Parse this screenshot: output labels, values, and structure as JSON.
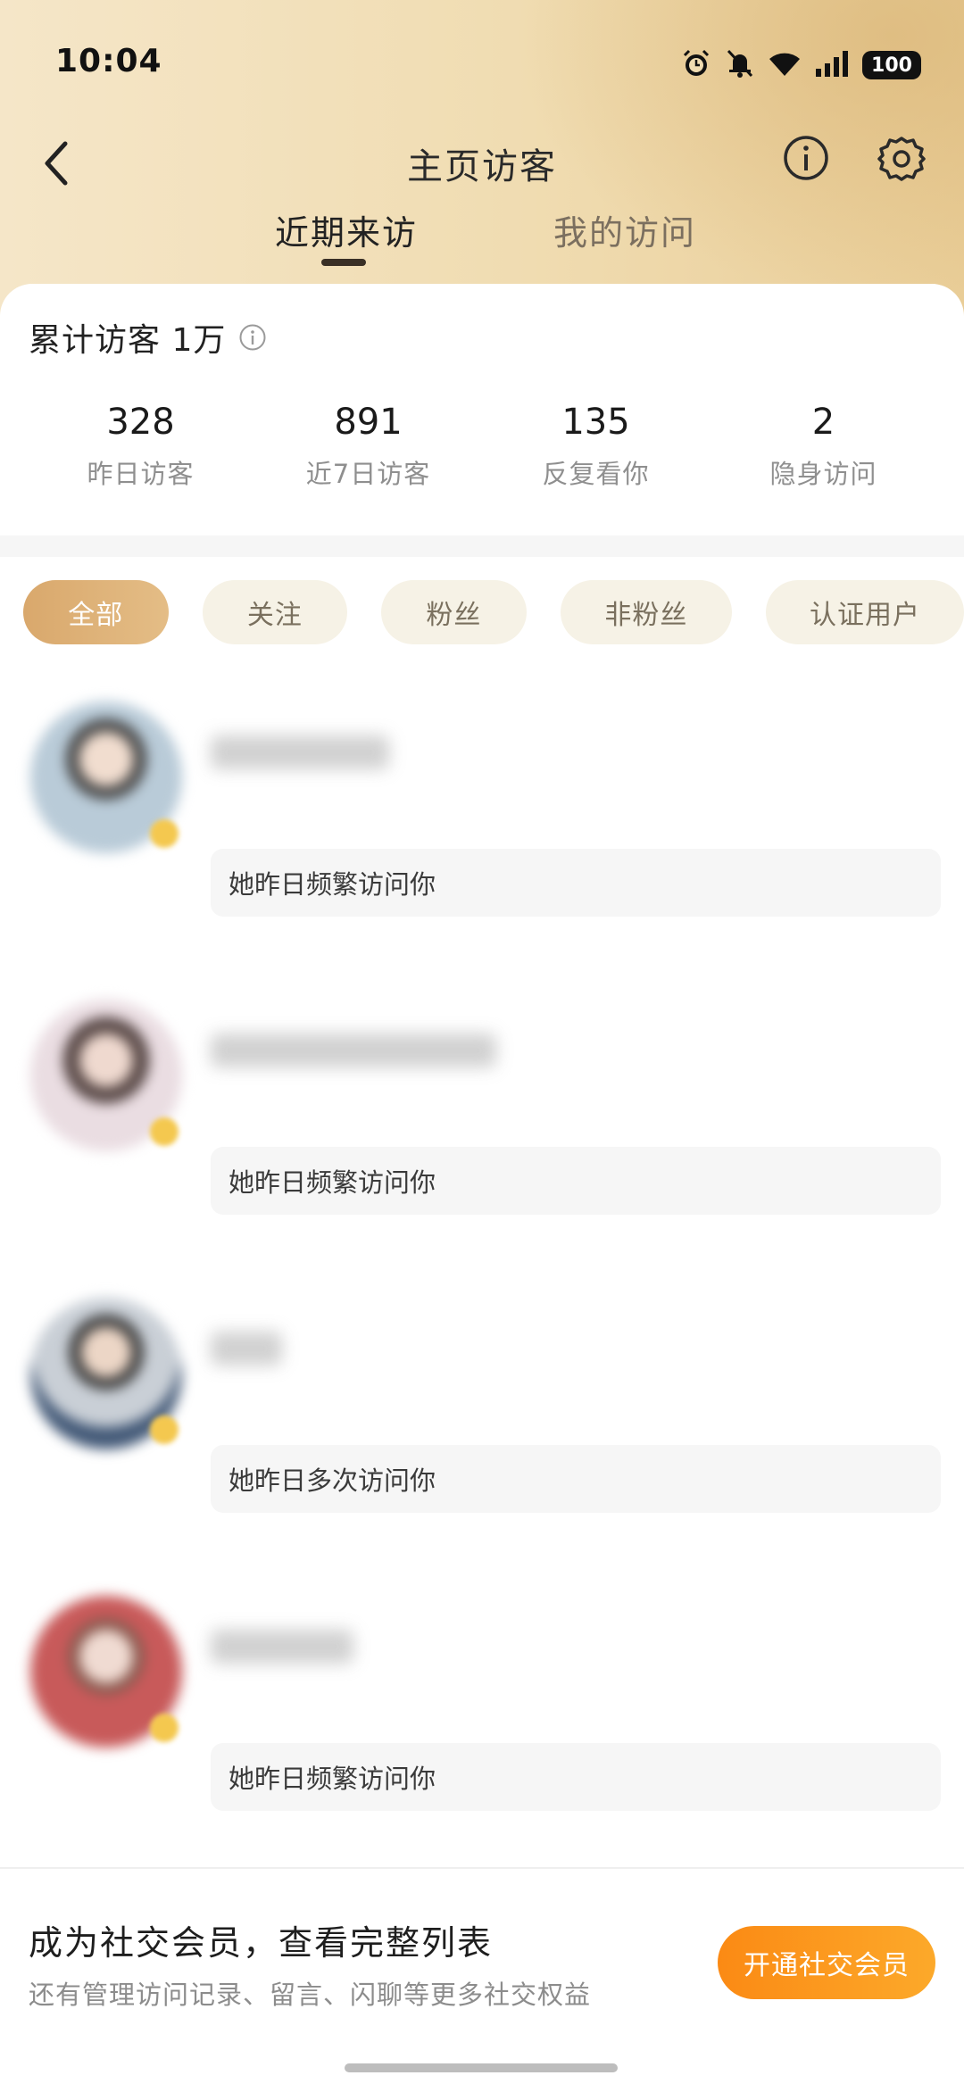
{
  "status_bar": {
    "time": "10:04",
    "battery": "100",
    "icons": [
      "alarm-icon",
      "mute-icon",
      "wifi-icon",
      "signal-icon",
      "battery-icon"
    ]
  },
  "header": {
    "title": "主页访客",
    "back_icon": "chevron-left-icon",
    "info_icon": "info-icon",
    "settings_icon": "gear-icon"
  },
  "tabs": [
    {
      "label": "近期来访",
      "active": true
    },
    {
      "label": "我的访问",
      "active": false
    }
  ],
  "summary": {
    "total_label": "累计访客 1万"
  },
  "stats": [
    {
      "value": "328",
      "label": "昨日访客"
    },
    {
      "value": "891",
      "label": "近7日访客"
    },
    {
      "value": "135",
      "label": "反复看你"
    },
    {
      "value": "2",
      "label": "隐身访问"
    }
  ],
  "filters": [
    {
      "label": "全部",
      "active": true
    },
    {
      "label": "关注",
      "active": false
    },
    {
      "label": "粉丝",
      "active": false
    },
    {
      "label": "非粉丝",
      "active": false
    },
    {
      "label": "认证用户",
      "active": false
    }
  ],
  "visitors": [
    {
      "note": "她昨日频繁访问你"
    },
    {
      "note": "她昨日频繁访问你"
    },
    {
      "note": "她昨日多次访问你"
    },
    {
      "note": "她昨日频繁访问你"
    }
  ],
  "promo": {
    "title": "成为社交会员，查看完整列表",
    "subtitle": "还有管理访问记录、留言、闪聊等更多社交权益",
    "button": "开通社交会员"
  },
  "colors": {
    "accent_orange": "#fb8a14",
    "chip_active": "#d9a86c",
    "header_gold": "#f0dcb1"
  }
}
